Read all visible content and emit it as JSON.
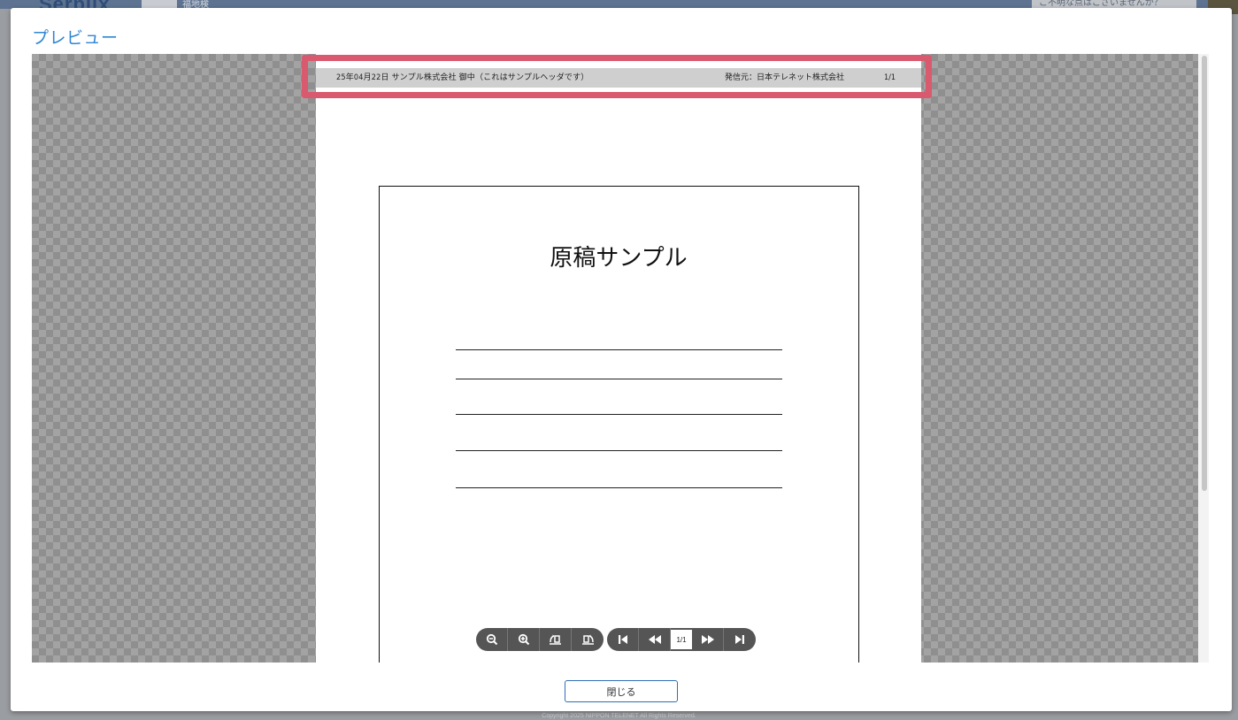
{
  "background": {
    "logo_text": "Serplix",
    "tab_label": "福地検",
    "help_text": "ご不明な点はございませんか？",
    "copyright": "Copyright 2025 NIPPON TELENET All Rights Reserved."
  },
  "modal": {
    "title": "プレビュー",
    "close_label": "閉じる"
  },
  "page_header": {
    "left": "25年04月22日 サンプル株式会社 御中（これはサンプルヘッダです）",
    "sender": "発信元：日本テレネット株式会社",
    "page": "1/1"
  },
  "document": {
    "title": "原稿サンプル",
    "line_count": 5
  },
  "toolbar": {
    "page_indicator": "1/1",
    "icons": [
      "zoom-out-icon",
      "zoom-in-icon",
      "rotate-left-icon",
      "rotate-right-icon",
      "first-page-icon",
      "previous-page-icon",
      "next-page-icon",
      "last-page-icon"
    ]
  },
  "colors": {
    "accent": "#2e86d4",
    "highlight": "#d9596e",
    "toolbar": "#555555"
  }
}
